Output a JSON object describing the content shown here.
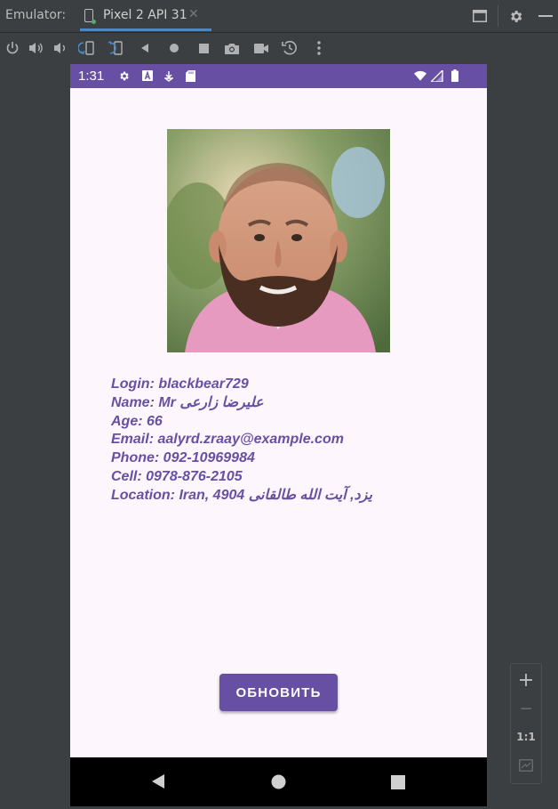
{
  "titlebar": {
    "label": "Emulator:",
    "tab_name": "Pixel 2 API 31",
    "tab_close": "✕"
  },
  "toolbar": {
    "icons": [
      "power-icon",
      "volume-up-icon",
      "volume-down-icon",
      "rotate-left-icon",
      "rotate-right-icon",
      "back-icon",
      "home-icon",
      "overview-icon",
      "screenshot-icon",
      "screenrecord-icon",
      "snapshot-icon",
      "more-icon"
    ]
  },
  "device": {
    "status_time": "1:31",
    "profile": {
      "login": "Login: blackbear729",
      "name": "Name: Mr علیرضا زارعی",
      "age": "Age: 66",
      "email": "Email: aalyrd.zraay@example.com",
      "phone": "Phone: 092-10969984",
      "cell": "Cell: 0978-876-2105",
      "location": "Location: Iran, 4904 یزد, آیت الله طالقانی"
    },
    "refresh_button": "ОБНОВИТЬ"
  },
  "zoom": {
    "plus": "+",
    "minus": "−",
    "one_to_one": "1:1"
  },
  "colors": {
    "accent": "#6750a4",
    "screen_bg": "#fdf7fd",
    "ide_bg": "#3c3f41"
  }
}
